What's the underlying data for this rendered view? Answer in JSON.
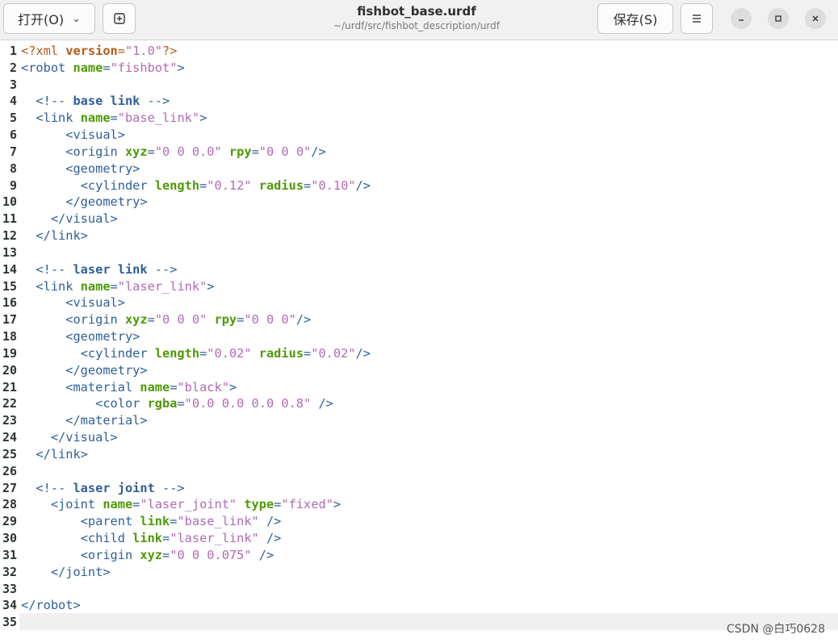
{
  "header": {
    "open_label": "打开(O)",
    "new_tab_icon": "new-tab-icon",
    "title": "fishbot_base.urdf",
    "subtitle": "~/urdf/src/fishbot_description/urdf",
    "save_label": "保存(S)",
    "menu_icon": "hamburger-menu-icon"
  },
  "window_controls": [
    "minimize-icon",
    "maximize-icon",
    "close-icon"
  ],
  "editor": {
    "current_line": 35,
    "lines": [
      "<?xml version=\"1.0\"?>",
      "<robot name=\"fishbot\">",
      "",
      "  <!-- base link -->",
      "  <link name=\"base_link\">",
      "      <visual>",
      "      <origin xyz=\"0 0 0.0\" rpy=\"0 0 0\"/>",
      "      <geometry>",
      "        <cylinder length=\"0.12\" radius=\"0.10\"/>",
      "      </geometry>",
      "    </visual>",
      "  </link>",
      "",
      "  <!-- laser link -->",
      "  <link name=\"laser_link\">",
      "      <visual>",
      "      <origin xyz=\"0 0 0\" rpy=\"0 0 0\"/>",
      "      <geometry>",
      "        <cylinder length=\"0.02\" radius=\"0.02\"/>",
      "      </geometry>",
      "      <material name=\"black\">",
      "          <color rgba=\"0.0 0.0 0.0 0.8\" />",
      "      </material>",
      "    </visual>",
      "  </link>",
      "",
      "  <!-- laser joint -->",
      "    <joint name=\"laser_joint\" type=\"fixed\">",
      "        <parent link=\"base_link\" />",
      "        <child link=\"laser_link\" />",
      "        <origin xyz=\"0 0 0.075\" />",
      "    </joint>",
      "",
      "</robot>",
      ""
    ]
  },
  "watermark": "CSDN @白巧0628",
  "colors": {
    "tag": "#2f5f9a",
    "attribute": "#4e9a06",
    "string": "#b16ab5",
    "processing_instruction": "#b25b16"
  }
}
